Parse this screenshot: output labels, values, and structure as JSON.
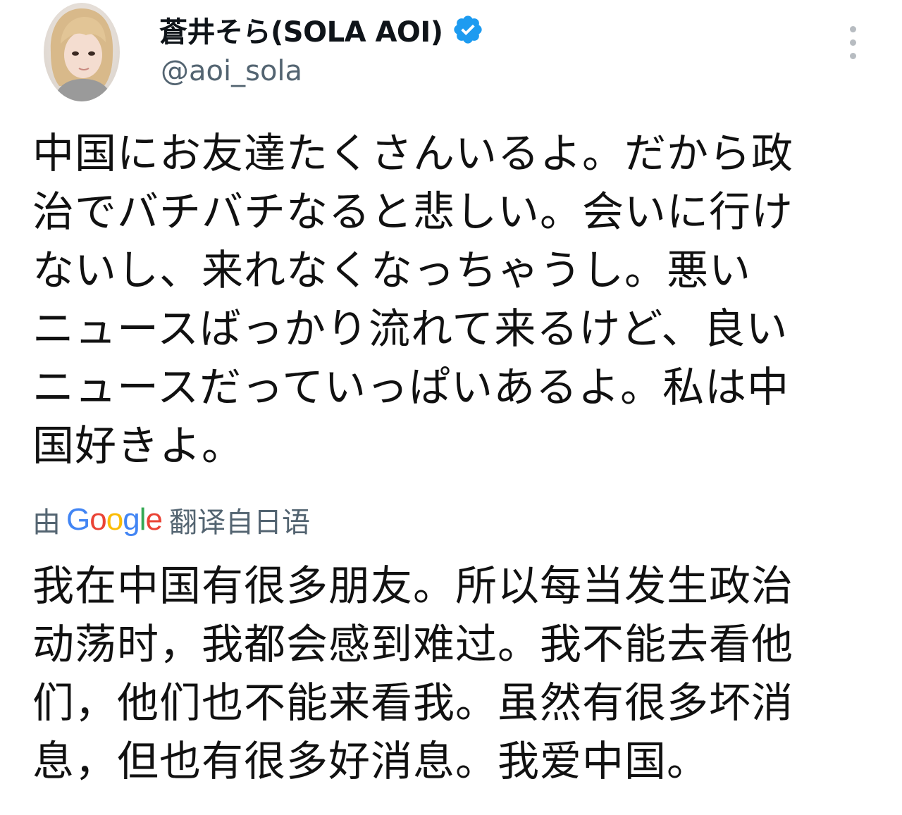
{
  "author": {
    "display_name": "蒼井そら(SOLA AOI)",
    "handle": "@aoi_sola",
    "verified": true,
    "avatar_icon": "profile-photo",
    "verified_icon": "verified-badge-icon",
    "more_icon": "more-options-icon"
  },
  "tweet": {
    "original_lines": [
      "中国にお友達たくさんいるよ。だから政",
      "治でバチバチなると悲しい。会いに行け",
      "ないし、来れなくなっちゃうし。悪い",
      "ニュースばっかり流れて来るけど、良い",
      "ニュースだっていっぱいあるよ。私は中",
      "国好きよ。"
    ],
    "translation_notice": {
      "prefix": "由",
      "provider": "Google",
      "suffix": "翻译自日语"
    },
    "translated_lines": [
      "我在中国有很多朋友。所以每当发生政治",
      "动荡时，我都会感到难过。我不能去看他",
      "们，他们也不能来看我。虽然有很多坏消",
      "息，但也有很多好消息。我爱中国。"
    ]
  },
  "colors": {
    "text_primary": "#0f1419",
    "text_secondary": "#536471",
    "verified_blue": "#1d9bf0",
    "google_blue": "#4285F4",
    "google_red": "#EA4335",
    "google_yellow": "#FBBC05",
    "google_green": "#34A853"
  }
}
